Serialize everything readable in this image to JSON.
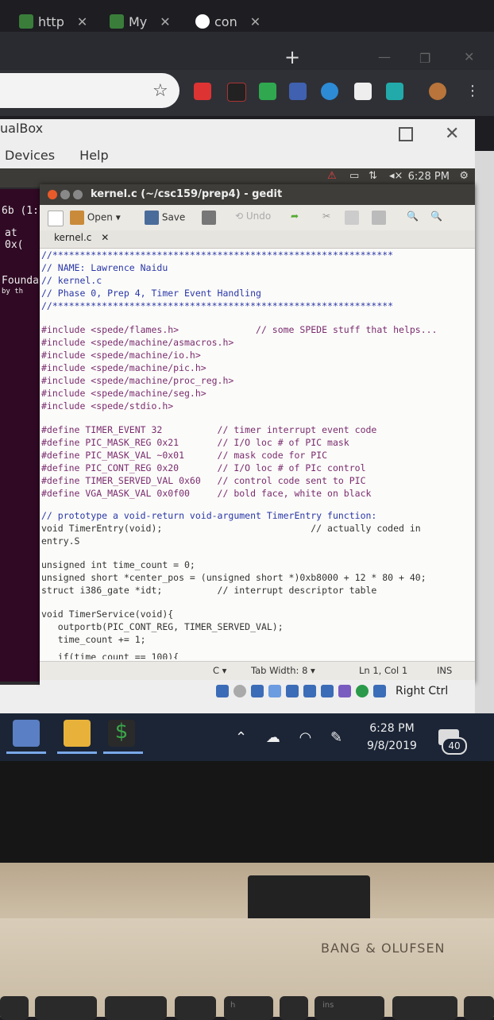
{
  "browser": {
    "tabs": [
      {
        "label": "http",
        "icon": "dollar-favicon-icon"
      },
      {
        "label": "My",
        "icon": "dollar-favicon-icon"
      },
      {
        "label": "con",
        "icon": "google-favicon-icon"
      }
    ]
  },
  "virtualbox": {
    "title": "ualBox",
    "menu": [
      "Devices",
      "Help"
    ],
    "status_right": "Right Ctrl"
  },
  "guest": {
    "topbar_time": "6:28 PM",
    "terminal_lines": [
      "6b  (1:",
      "at 0x(",
      "Founda",
      "by th"
    ]
  },
  "gedit": {
    "title": "kernel.c (~/csc159/prep4) - gedit",
    "toolbar": {
      "open": "Open",
      "save": "Save",
      "undo": "Undo"
    },
    "tab": "kernel.c",
    "code_lines": [
      "//**************************************************************",
      "// NAME: Lawrence Naidu",
      "// kernel.c",
      "// Phase 0, Prep 4, Timer Event Handling",
      "//**************************************************************",
      "",
      "#include <spede/flames.h>              // some SPEDE stuff that helps...",
      "#include <spede/machine/asmacros.h>",
      "#include <spede/machine/io.h>",
      "#include <spede/machine/pic.h>",
      "#include <spede/machine/proc_reg.h>",
      "#include <spede/machine/seg.h>",
      "#include <spede/stdio.h>",
      "",
      "#define TIMER_EVENT 32          // timer interrupt event code",
      "#define PIC_MASK_REG 0x21       // I/O loc # of PIC mask",
      "#define PIC_MASK_VAL ~0x01      // mask code for PIC",
      "#define PIC_CONT_REG 0x20       // I/O loc # of PIc control",
      "#define TIMER_SERVED_VAL 0x60   // control code sent to PIC",
      "#define VGA_MASK_VAL 0x0f00     // bold face, white on black",
      "",
      "// prototype a void-return void-argument TimerEntry function:",
      "void TimerEntry(void);                           // actually coded in",
      "entry.S",
      "",
      "unsigned int time_count = 0;",
      "unsigned short *center_pos = (unsigned short *)0xb8000 + 12 * 80 + 40;",
      "struct i386_gate *idt;          // interrupt descriptor table",
      "",
      "void TimerService(void){",
      "   outportb(PIC_CONT_REG, TIMER_SERVED_VAL);",
      "   time_count += 1;",
      "",
      "   if(time_count == 100){"
    ],
    "status": {
      "lang": "C",
      "tab_width": "Tab Width: 8",
      "position": "Ln 1, Col 1",
      "mode": "INS"
    }
  },
  "taskbar": {
    "time": "6:28 PM",
    "date": "9/8/2019",
    "notifications": "40"
  },
  "laptop": {
    "brand": "BANG & OLUFSEN",
    "keys": [
      "h",
      "ins"
    ]
  },
  "colors": {
    "comment": "#2a37a8",
    "preproc": "#7a2c6e",
    "string": "#c8389c",
    "taskbar": "#1b2536"
  }
}
